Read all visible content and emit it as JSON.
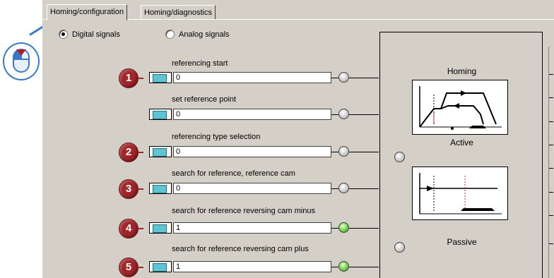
{
  "tabs": [
    {
      "label": "Homing/configuration",
      "active": true
    },
    {
      "label": "Homing/diagnostics",
      "active": false
    }
  ],
  "signal_mode": {
    "digital_label": "Digital signals",
    "analog_label": "Analog signals",
    "selected": "digital"
  },
  "signals": [
    {
      "badge": "1",
      "label": "referencing start",
      "value": "0",
      "led": "grey"
    },
    {
      "badge": "",
      "label": "set reference point",
      "value": "0",
      "led": "grey"
    },
    {
      "badge": "2",
      "label": "referencing type selection",
      "value": "0",
      "led": "grey"
    },
    {
      "badge": "3",
      "label": "search for reference, reference cam",
      "value": "0",
      "led": "grey"
    },
    {
      "badge": "4",
      "label": "search for reference reversing cam minus",
      "value": "1",
      "led": "green"
    },
    {
      "badge": "5",
      "label": "search for reference reversing cam plus",
      "value": "1",
      "led": "green"
    }
  ],
  "diagram": {
    "title": "Homing",
    "active_label": "Active",
    "passive_label": "Passive"
  },
  "colors": {
    "panel_bg": "#d4d0c8",
    "badge": "#a0262a",
    "led_green": "#6fd04a",
    "connector": "#5ec4d4",
    "mouse_outline": "#3a79c9"
  }
}
